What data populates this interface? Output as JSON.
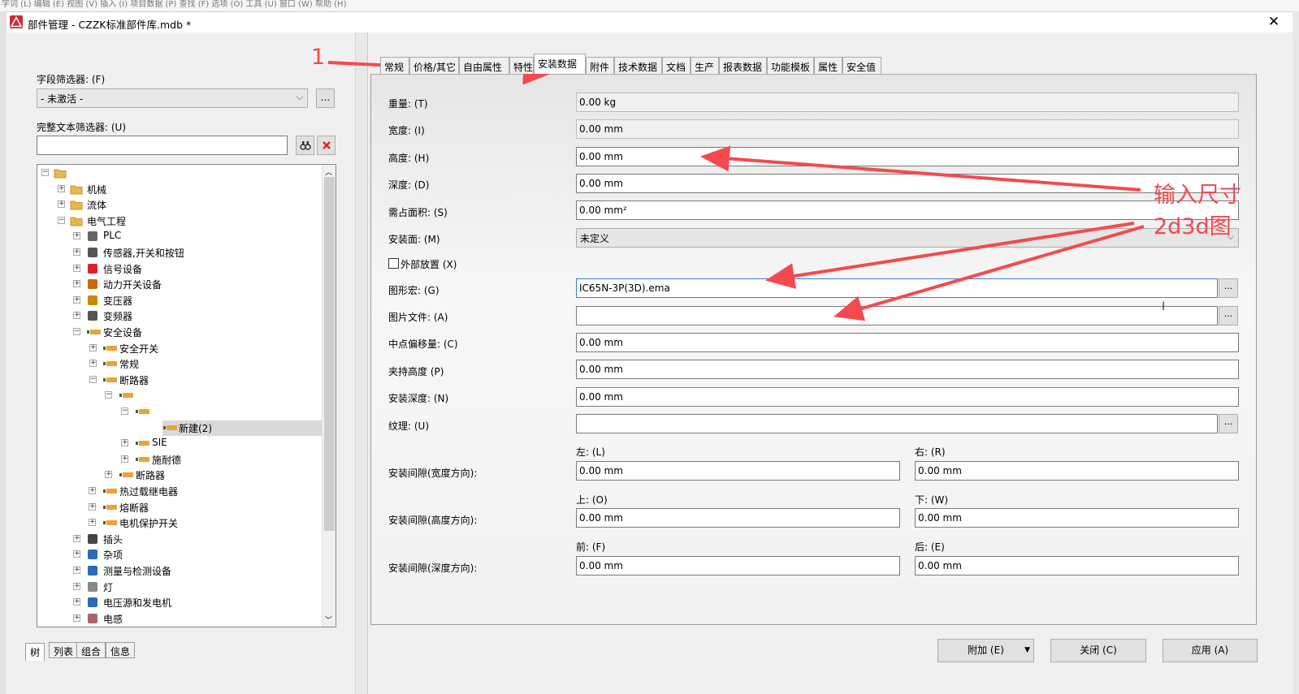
{
  "bg_menu": "字词 (L)   编辑 (E)   视图 (V)   插入 (I)   项目数据 (P)   查找 (F)   选项 (O)   工具 (U)   窗口 (W)   帮助 (H)",
  "window": {
    "title": "部件管理 - CZZK标准部件库.mdb *",
    "close": "✕"
  },
  "left": {
    "field_filter_label": "字段筛选器: (F)",
    "field_filter_value": "- 未激活 -",
    "ellipsis": "...",
    "fulltext_label": "完整文本筛选器: (U)",
    "fulltext_value": "",
    "tree": [
      {
        "label": "",
        "icon": "folder-icon",
        "exp": "⊟"
      },
      {
        "label": "机械",
        "icon": "folder-icon",
        "exp": "+"
      },
      {
        "label": "流体",
        "icon": "folder-icon",
        "exp": "+"
      },
      {
        "label": "电气工程",
        "icon": "folder-icon",
        "exp": "−"
      },
      {
        "label": "PLC",
        "icon": "plc-icon",
        "exp": "+"
      },
      {
        "label": "传感器,开关和按钮",
        "icon": "sensor-icon",
        "exp": "+"
      },
      {
        "label": "信号设备",
        "icon": "signal-icon",
        "exp": "+"
      },
      {
        "label": "动力开关设备",
        "icon": "power-switch-icon",
        "exp": "+"
      },
      {
        "label": "变压器",
        "icon": "transformer-icon",
        "exp": "+"
      },
      {
        "label": "变频器",
        "icon": "inverter-icon",
        "exp": "+"
      },
      {
        "label": "安全设备",
        "icon": "part-icon",
        "exp": "−"
      },
      {
        "label": "安全开关",
        "icon": "part-icon",
        "exp": "+"
      },
      {
        "label": "常规",
        "icon": "part-icon",
        "exp": "+"
      },
      {
        "label": "断路器",
        "icon": "part-icon",
        "exp": "−"
      },
      {
        "label": "",
        "icon": "part-icon",
        "exp": "−"
      },
      {
        "label": "",
        "icon": "part-icon",
        "exp": "−"
      },
      {
        "label": "新建(2)",
        "icon": "part-icon",
        "exp": ""
      },
      {
        "label": "SIE",
        "icon": "part-icon",
        "exp": "+"
      },
      {
        "label": "施耐德",
        "icon": "part-icon",
        "exp": "+"
      },
      {
        "label": "断路器",
        "icon": "part-icon",
        "exp": "+"
      },
      {
        "label": "热过载继电器",
        "icon": "part-icon",
        "exp": "+"
      },
      {
        "label": "熔断器",
        "icon": "part-icon",
        "exp": "+"
      },
      {
        "label": "电机保护开关",
        "icon": "part-icon",
        "exp": "+"
      },
      {
        "label": "插头",
        "icon": "plug-icon",
        "exp": "+"
      },
      {
        "label": "杂项",
        "icon": "misc-icon",
        "exp": "+"
      },
      {
        "label": "测量与检测设备",
        "icon": "meter-icon",
        "exp": "+"
      },
      {
        "label": "灯",
        "icon": "lamp-icon",
        "exp": "+"
      },
      {
        "label": "电压源和发电机",
        "icon": "generator-icon",
        "exp": "+"
      },
      {
        "label": "电感",
        "icon": "inductor-icon",
        "exp": "+"
      }
    ],
    "bottom_tabs": [
      "树",
      "列表",
      "组合",
      "信息"
    ]
  },
  "tabs": [
    "常规",
    "价格/其它",
    "自由属性",
    "特性",
    "安装数据",
    "附件",
    "技术数据",
    "文档",
    "生产",
    "报表数据",
    "功能模板",
    "属性",
    "安全值"
  ],
  "fields": {
    "weight": {
      "label": "重量: (T)",
      "value": "0.00 kg"
    },
    "width": {
      "label": "宽度: (I)",
      "value": "0.00 mm"
    },
    "height": {
      "label": "高度: (H)",
      "value": "0.00 mm"
    },
    "depth": {
      "label": "深度: (D)",
      "value": "0.00 mm"
    },
    "area": {
      "label": "需占面积: (S)",
      "value": "0.00 mm²"
    },
    "mount_surface": {
      "label": "安装面: (M)",
      "value": "未定义"
    },
    "external": {
      "label": "外部放置 (X)"
    },
    "graphic_macro": {
      "label": "图形宏: (G)",
      "value": "IC65N-3P(3D).ema"
    },
    "image_file": {
      "label": "图片文件: (A)",
      "value": ""
    },
    "center_offset": {
      "label": "中点偏移量: (C)",
      "value": "0.00 mm"
    },
    "clamp_height": {
      "label": "夹持高度 (P)",
      "value": "0.00 mm"
    },
    "install_depth": {
      "label": "安装深度: (N)",
      "value": "0.00 mm"
    },
    "texture": {
      "label": "纹理: (U)",
      "value": ""
    },
    "gap_width": {
      "label": "安装间隙(宽度方向):",
      "left_label": "左: (L)",
      "left": "0.00 mm",
      "right_label": "右: (R)",
      "right": "0.00 mm"
    },
    "gap_height": {
      "label": "安装间隙(高度方向):",
      "top_label": "上: (O)",
      "top": "0.00 mm",
      "bottom_label": "下: (W)",
      "bottom": "0.00 mm"
    },
    "gap_depth": {
      "label": "安装间隙(深度方向):",
      "front_label": "前: (F)",
      "front": "0.00 mm",
      "back_label": "后: (E)",
      "back": "0.00 mm"
    }
  },
  "buttons": {
    "add": "附加 (E)",
    "close": "关闭 (C)",
    "apply": "应用 (A)"
  },
  "annotations": {
    "step1": "1",
    "note1": "输入尺寸",
    "note2": "2d3d图",
    "color": "#f44a4f"
  }
}
